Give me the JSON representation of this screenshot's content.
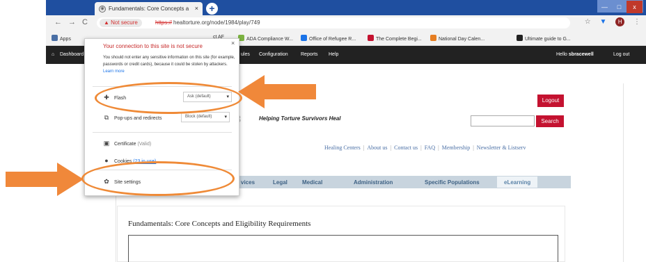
{
  "browser": {
    "tab_title": "Fundamentals: Core Concepts a",
    "tab_close": "×",
    "new_tab": "+",
    "window_buttons": [
      "—",
      "□",
      "x"
    ],
    "nav": {
      "back": "←",
      "forward": "→",
      "reload": "C"
    },
    "address": {
      "security_chip": "▲ Not secure",
      "scheme": "https://",
      "rest": "healtorture.org/node/1984/play/749"
    },
    "toolbar_icons": {
      "star": "☆",
      "ext": "▼",
      "avatar": "H",
      "menu": "⋮"
    }
  },
  "bookmarks": [
    {
      "label": "Apps",
      "color": "#4a6fa5"
    },
    {
      "label": "ct AF",
      "color": "#999999"
    },
    {
      "label": "ADA Compliance W...",
      "color": "#7cb342"
    },
    {
      "label": "Office of Refugee R...",
      "color": "#1a73e8"
    },
    {
      "label": "The Complete Begi...",
      "color": "#c41230"
    },
    {
      "label": "National Day Calen...",
      "color": "#e67e22"
    },
    {
      "label": "Ultimate guide to G...",
      "color": "#222222"
    }
  ],
  "admin_bar": {
    "home": "⌂",
    "dashboard": "Dashboard",
    "structure_partial": "ules",
    "configuration": "Configuration",
    "reports": "Reports",
    "help": "Help",
    "greeting_prefix": "Hello",
    "username": "sbracewell",
    "logout": "Log out"
  },
  "site_info": {
    "title": "Your connection to this site is not secure",
    "close": "×",
    "warning": "You should not enter any sensitive information on this site (for example, passwords or credit cards), because it could be stolen by attackers.",
    "learn_more": "Learn more",
    "flash": {
      "label": "Flash",
      "value": "Ask (default)"
    },
    "popups": {
      "label": "Pop-ups and redirects",
      "value": "Block (default)"
    },
    "certificate": {
      "label": "Certificate",
      "status": "(Valid)"
    },
    "cookies": {
      "label": "Cookies",
      "status": "(23 in use)"
    },
    "site_settings": "Site settings"
  },
  "page": {
    "logout_button": "Logout",
    "search_button": "Search",
    "tagline": "Helping Torture Survivors Heal",
    "sublinks": [
      "Healing Centers",
      "About us",
      "Contact us",
      "FAQ",
      "Membership",
      "Newsletter & Listserv"
    ],
    "main_nav": [
      "vices",
      "Legal",
      "Medical",
      "Administration",
      "Specific Populations",
      "eLearning"
    ],
    "content_title": "Fundamentals: Core Concepts and Eligibility Requirements"
  },
  "colors": {
    "annotation": "#ef8a37",
    "brand_red": "#c41230",
    "tabstrip_blue": "#1f4fa0"
  }
}
